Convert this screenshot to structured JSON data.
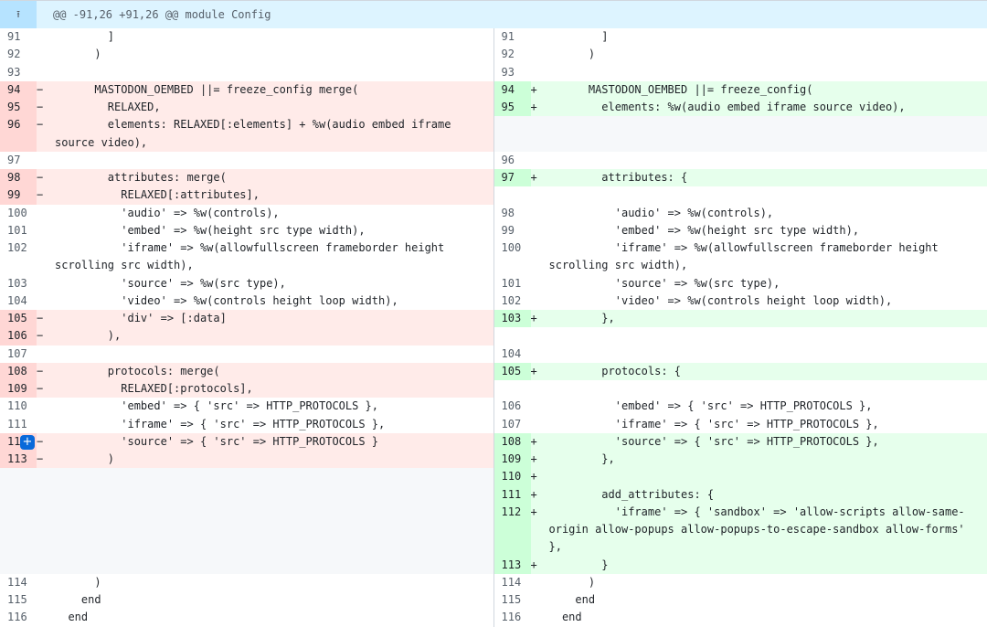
{
  "hunk": {
    "expand_icon": "expand-up-icon",
    "header": "@@ -91,26 +91,26 @@ module Config"
  },
  "left": [
    {
      "n": "91",
      "t": "ctx",
      "c": "        ]"
    },
    {
      "n": "92",
      "t": "ctx",
      "c": "      )"
    },
    {
      "n": "93",
      "t": "ctx",
      "c": ""
    },
    {
      "n": "94",
      "t": "del",
      "c": "      MASTODON_OEMBED ||= freeze_config merge("
    },
    {
      "n": "95",
      "t": "del",
      "c": "        RELAXED,"
    },
    {
      "n": "96",
      "t": "del",
      "c": "        elements: RELAXED[:elements] + %w(audio embed iframe source video),",
      "tall": true
    },
    {
      "n": "97",
      "t": "ctx",
      "c": ""
    },
    {
      "n": "98",
      "t": "del",
      "c": "        attributes: merge("
    },
    {
      "n": "99",
      "t": "del",
      "c": "          RELAXED[:attributes],"
    },
    {
      "n": "100",
      "t": "ctx",
      "c": "          'audio' => %w(controls),"
    },
    {
      "n": "101",
      "t": "ctx",
      "c": "          'embed' => %w(height src type width),"
    },
    {
      "n": "102",
      "t": "ctx",
      "c": "          'iframe' => %w(allowfullscreen frameborder height scrolling src width),",
      "tall": true
    },
    {
      "n": "103",
      "t": "ctx",
      "c": "          'source' => %w(src type),"
    },
    {
      "n": "104",
      "t": "ctx",
      "c": "          'video' => %w(controls height loop width),"
    },
    {
      "n": "105",
      "t": "del",
      "c": "          'div' => [:data]"
    },
    {
      "n": "106",
      "t": "del",
      "c": "        ),"
    },
    {
      "n": "107",
      "t": "ctx",
      "c": ""
    },
    {
      "n": "108",
      "t": "del",
      "c": "        protocols: merge("
    },
    {
      "n": "109",
      "t": "del",
      "c": "          RELAXED[:protocols],"
    },
    {
      "n": "110",
      "t": "ctx",
      "c": "          'embed' => { 'src' => HTTP_PROTOCOLS },"
    },
    {
      "n": "111",
      "t": "ctx",
      "c": "          'iframe' => { 'src' => HTTP_PROTOCOLS },"
    },
    {
      "n": "112",
      "t": "del",
      "c": "          'source' => { 'src' => HTTP_PROTOCOLS }",
      "plus": true
    },
    {
      "n": "113",
      "t": "del",
      "c": "        )"
    },
    {
      "n": "",
      "t": "empty",
      "c": ""
    },
    {
      "n": "",
      "t": "empty",
      "c": ""
    },
    {
      "n": "",
      "t": "empty",
      "c": ""
    },
    {
      "n": "",
      "t": "empty",
      "c": "",
      "tall": true
    },
    {
      "n": "",
      "t": "empty",
      "c": ""
    },
    {
      "n": "114",
      "t": "ctx",
      "c": "      )"
    },
    {
      "n": "115",
      "t": "ctx",
      "c": "    end"
    },
    {
      "n": "116",
      "t": "ctx",
      "c": "  end"
    }
  ],
  "right": [
    {
      "n": "91",
      "t": "ctx",
      "c": "        ]"
    },
    {
      "n": "92",
      "t": "ctx",
      "c": "      )"
    },
    {
      "n": "93",
      "t": "ctx",
      "c": ""
    },
    {
      "n": "94",
      "t": "add",
      "c": "      MASTODON_OEMBED ||= freeze_config("
    },
    {
      "n": "95",
      "t": "add",
      "c": "        elements: %w(audio embed iframe source video),"
    },
    {
      "n": "",
      "t": "empty",
      "c": "",
      "tall": true
    },
    {
      "n": "96",
      "t": "ctx",
      "c": ""
    },
    {
      "n": "97",
      "t": "add",
      "c": "        attributes: {"
    },
    {
      "n": "",
      "t": "ctx",
      "c": ""
    },
    {
      "n": "98",
      "t": "ctx",
      "c": "          'audio' => %w(controls),"
    },
    {
      "n": "99",
      "t": "ctx",
      "c": "          'embed' => %w(height src type width),"
    },
    {
      "n": "100",
      "t": "ctx",
      "c": "          'iframe' => %w(allowfullscreen frameborder height scrolling src width),",
      "tall": true
    },
    {
      "n": "101",
      "t": "ctx",
      "c": "          'source' => %w(src type),"
    },
    {
      "n": "102",
      "t": "ctx",
      "c": "          'video' => %w(controls height loop width),"
    },
    {
      "n": "103",
      "t": "add",
      "c": "        },"
    },
    {
      "n": "",
      "t": "ctx",
      "c": ""
    },
    {
      "n": "104",
      "t": "ctx",
      "c": ""
    },
    {
      "n": "105",
      "t": "add",
      "c": "        protocols: {"
    },
    {
      "n": "",
      "t": "ctx",
      "c": ""
    },
    {
      "n": "106",
      "t": "ctx",
      "c": "          'embed' => { 'src' => HTTP_PROTOCOLS },"
    },
    {
      "n": "107",
      "t": "ctx",
      "c": "          'iframe' => { 'src' => HTTP_PROTOCOLS },"
    },
    {
      "n": "108",
      "t": "add",
      "c": "          'source' => { 'src' => HTTP_PROTOCOLS },"
    },
    {
      "n": "109",
      "t": "add",
      "c": "        },"
    },
    {
      "n": "110",
      "t": "add",
      "c": ""
    },
    {
      "n": "111",
      "t": "add",
      "c": "        add_attributes: {"
    },
    {
      "n": "112",
      "t": "add",
      "c": "          'iframe' => { 'sandbox' => 'allow-scripts allow-same-origin allow-popups allow-popups-to-escape-sandbox allow-forms' },",
      "tall": true
    },
    {
      "n": "113",
      "t": "add",
      "c": "        }"
    },
    {
      "n": "114",
      "t": "ctx",
      "c": "      )"
    },
    {
      "n": "115",
      "t": "ctx",
      "c": "    end"
    },
    {
      "n": "116",
      "t": "ctx",
      "c": "  end"
    }
  ],
  "signs": {
    "del": "−",
    "add": "+"
  }
}
